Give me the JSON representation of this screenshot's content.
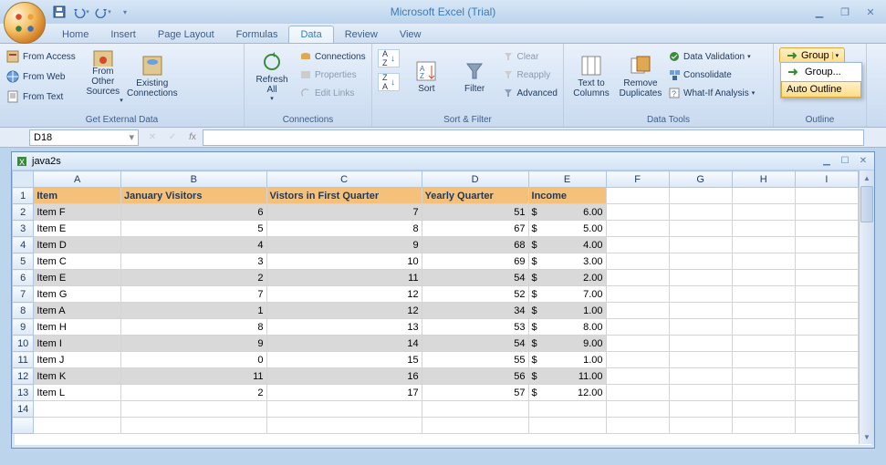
{
  "title": "Microsoft Excel (Trial)",
  "qat": {
    "save": "save-icon",
    "undo": "undo-icon",
    "redo": "redo-icon"
  },
  "tabs": [
    "Home",
    "Insert",
    "Page Layout",
    "Formulas",
    "Data",
    "Review",
    "View"
  ],
  "active_tab": "Data",
  "ribbon": {
    "get_external": {
      "from_access": "From Access",
      "from_web": "From Web",
      "from_text": "From Text",
      "other": "From Other Sources",
      "existing": "Existing Connections",
      "label": "Get External Data"
    },
    "connections": {
      "refresh": "Refresh All",
      "connections": "Connections",
      "properties": "Properties",
      "edit_links": "Edit Links",
      "label": "Connections"
    },
    "sort_filter": {
      "az": "A→Z",
      "za": "Z→A",
      "sort": "Sort",
      "filter": "Filter",
      "clear": "Clear",
      "reapply": "Reapply",
      "advanced": "Advanced",
      "label": "Sort & Filter"
    },
    "data_tools": {
      "text_to_cols": "Text to Columns",
      "remove_dup": "Remove Duplicates",
      "validation": "Data Validation",
      "consolidate": "Consolidate",
      "whatif": "What-If Analysis",
      "label": "Data Tools"
    },
    "outline": {
      "group": "Group",
      "menu_group": "Group...",
      "menu_auto": "Auto Outline",
      "label": "Outline"
    }
  },
  "namebox": "D18",
  "workbook_title": "java2s",
  "columns": [
    "A",
    "B",
    "C",
    "D",
    "E",
    "F",
    "G",
    "H",
    "I"
  ],
  "headers": {
    "A": "Item",
    "B": "January Visitors",
    "C": "Vistors in First Quarter",
    "D": "Yearly Quarter",
    "E": "Income"
  },
  "rows": [
    {
      "n": 2,
      "shade": true,
      "A": "Item F",
      "B": "6",
      "C": "7",
      "D": "51",
      "EC": "$",
      "E": "6.00"
    },
    {
      "n": 3,
      "shade": false,
      "A": "Item E",
      "B": "5",
      "C": "8",
      "D": "67",
      "EC": "$",
      "E": "5.00"
    },
    {
      "n": 4,
      "shade": true,
      "A": "Item D",
      "B": "4",
      "C": "9",
      "D": "68",
      "EC": "$",
      "E": "4.00"
    },
    {
      "n": 5,
      "shade": false,
      "A": "Item C",
      "B": "3",
      "C": "10",
      "D": "69",
      "EC": "$",
      "E": "3.00"
    },
    {
      "n": 6,
      "shade": true,
      "A": "Item E",
      "B": "2",
      "C": "11",
      "D": "54",
      "EC": "$",
      "E": "2.00"
    },
    {
      "n": 7,
      "shade": false,
      "A": "Item G",
      "B": "7",
      "C": "12",
      "D": "52",
      "EC": "$",
      "E": "7.00"
    },
    {
      "n": 8,
      "shade": true,
      "A": "Item A",
      "B": "1",
      "C": "12",
      "D": "34",
      "EC": "$",
      "E": "1.00"
    },
    {
      "n": 9,
      "shade": false,
      "A": "Item H",
      "B": "8",
      "C": "13",
      "D": "53",
      "EC": "$",
      "E": "8.00"
    },
    {
      "n": 10,
      "shade": true,
      "A": "Item I",
      "B": "9",
      "C": "14",
      "D": "54",
      "EC": "$",
      "E": "9.00"
    },
    {
      "n": 11,
      "shade": false,
      "A": "Item J",
      "B": "0",
      "C": "15",
      "D": "55",
      "EC": "$",
      "E": "1.00"
    },
    {
      "n": 12,
      "shade": true,
      "A": "Item K",
      "B": "11",
      "C": "16",
      "D": "56",
      "EC": "$",
      "E": "11.00"
    },
    {
      "n": 13,
      "shade": false,
      "A": "Item L",
      "B": "2",
      "C": "17",
      "D": "57",
      "EC": "$",
      "E": "12.00"
    }
  ],
  "col_widths": {
    "A": 90,
    "B": 150,
    "C": 160,
    "D": 110,
    "E": 80,
    "F": 65,
    "G": 65,
    "H": 65,
    "I": 65
  }
}
